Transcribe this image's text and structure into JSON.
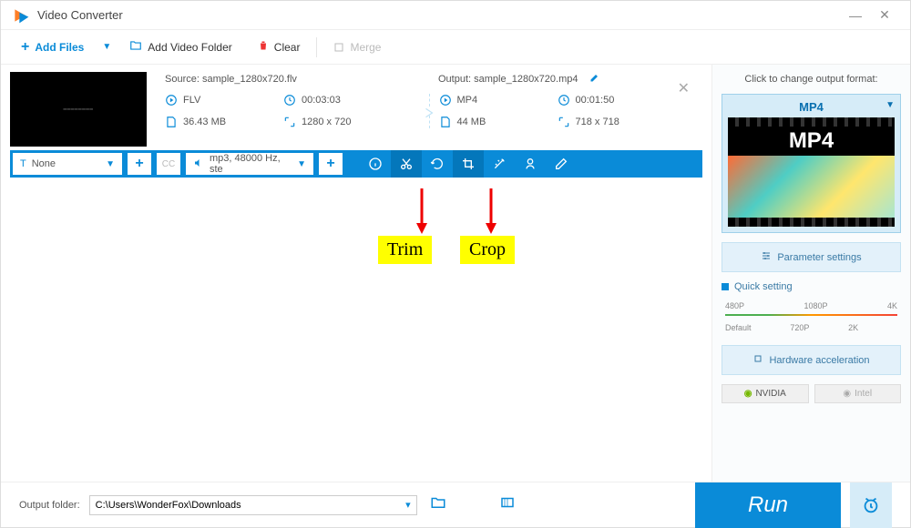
{
  "title": "Video Converter",
  "toolbar": {
    "add_files": "Add Files",
    "add_folder": "Add Video Folder",
    "clear": "Clear",
    "merge": "Merge"
  },
  "file": {
    "source_label": "Source: sample_1280x720.flv",
    "output_label": "Output: sample_1280x720.mp4",
    "src_format": "FLV",
    "src_duration": "00:03:03",
    "src_size": "36.43 MB",
    "src_res": "1280 x 720",
    "out_format": "MP4",
    "out_duration": "00:01:50",
    "out_size": "44 MB",
    "out_res": "718 x 718"
  },
  "actionbar": {
    "subtitle_sel": "None",
    "audio_sel": "mp3, 48000 Hz, ste"
  },
  "annotations": {
    "trim": "Trim",
    "crop": "Crop"
  },
  "sidebar": {
    "change_fmt": "Click to change output format:",
    "fmt_name": "MP4",
    "fmt_badge": "MP4",
    "param_settings": "Parameter settings",
    "quick_setting": "Quick setting",
    "q480": "480P",
    "q720": "720P",
    "q1080": "1080P",
    "q2k": "2K",
    "q4k": "4K",
    "default": "Default",
    "hw_accel": "Hardware acceleration",
    "nvidia": "NVIDIA",
    "intel": "Intel"
  },
  "bottom": {
    "output_folder_label": "Output folder:",
    "output_folder_value": "C:\\Users\\WonderFox\\Downloads",
    "run": "Run"
  }
}
